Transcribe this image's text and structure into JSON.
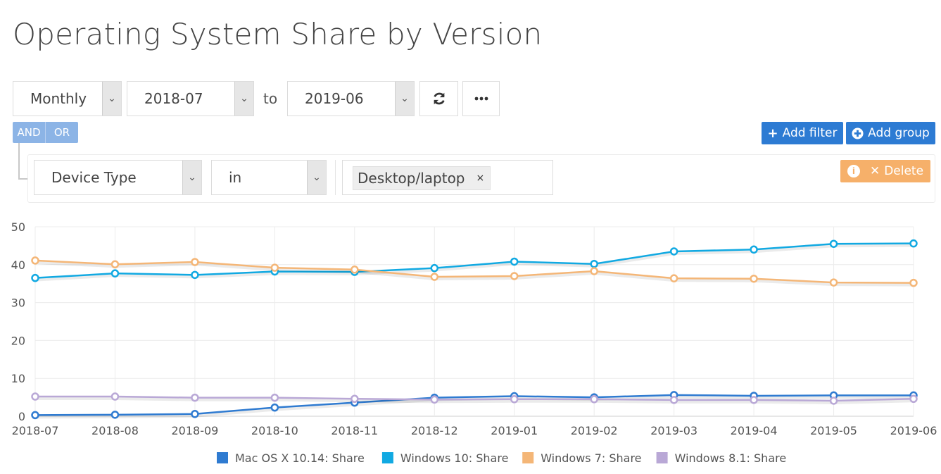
{
  "title": "Operating System Share by Version",
  "controls": {
    "interval": "Monthly",
    "from": "2018-07",
    "to_label": "to",
    "to": "2019-06",
    "refresh_icon": "refresh-icon",
    "more_icon": "more-icon"
  },
  "logic": {
    "and_label": "AND",
    "or_label": "OR"
  },
  "buttons": {
    "add_filter": "Add filter",
    "add_group": "Add group",
    "delete": "Delete"
  },
  "filter": {
    "field": "Device Type",
    "operator": "in",
    "value_tag": "Desktop/laptop",
    "remove_symbol": "×"
  },
  "colors": {
    "primary_button": "#2d7bd3",
    "delete_button": "#f6b06a",
    "mac": "#2f7bd1",
    "win10": "#11a9e2",
    "win7": "#f4b677",
    "win81": "#b9a8d6"
  },
  "chart_data": {
    "type": "line",
    "x": [
      "2018-07",
      "2018-08",
      "2018-09",
      "2018-10",
      "2018-11",
      "2018-12",
      "2019-01",
      "2019-02",
      "2019-03",
      "2019-04",
      "2019-05",
      "2019-06"
    ],
    "ylim": [
      0,
      50
    ],
    "yticks": [
      0,
      10,
      20,
      30,
      40,
      50
    ],
    "grid": true,
    "legend_position": "bottom",
    "series": [
      {
        "name": "Mac OS X 10.14: Share",
        "color": "#2f7bd1",
        "values": [
          0.3,
          0.4,
          0.6,
          2.3,
          3.6,
          4.9,
          5.3,
          5.0,
          5.6,
          5.4,
          5.5,
          5.5
        ]
      },
      {
        "name": "Windows 10: Share",
        "color": "#11a9e2",
        "values": [
          36.5,
          37.7,
          37.3,
          38.2,
          38.1,
          39.1,
          40.8,
          40.2,
          43.5,
          44.0,
          45.5,
          45.6
        ]
      },
      {
        "name": "Windows 7: Share",
        "color": "#f4b677",
        "values": [
          41.1,
          40.1,
          40.7,
          39.2,
          38.7,
          36.8,
          37.0,
          38.3,
          36.4,
          36.3,
          35.3,
          35.2
        ]
      },
      {
        "name": "Windows 8.1: Share",
        "color": "#b9a8d6",
        "values": [
          5.2,
          5.2,
          4.9,
          4.9,
          4.6,
          4.4,
          4.5,
          4.5,
          4.3,
          4.3,
          4.1,
          4.6
        ]
      }
    ]
  }
}
